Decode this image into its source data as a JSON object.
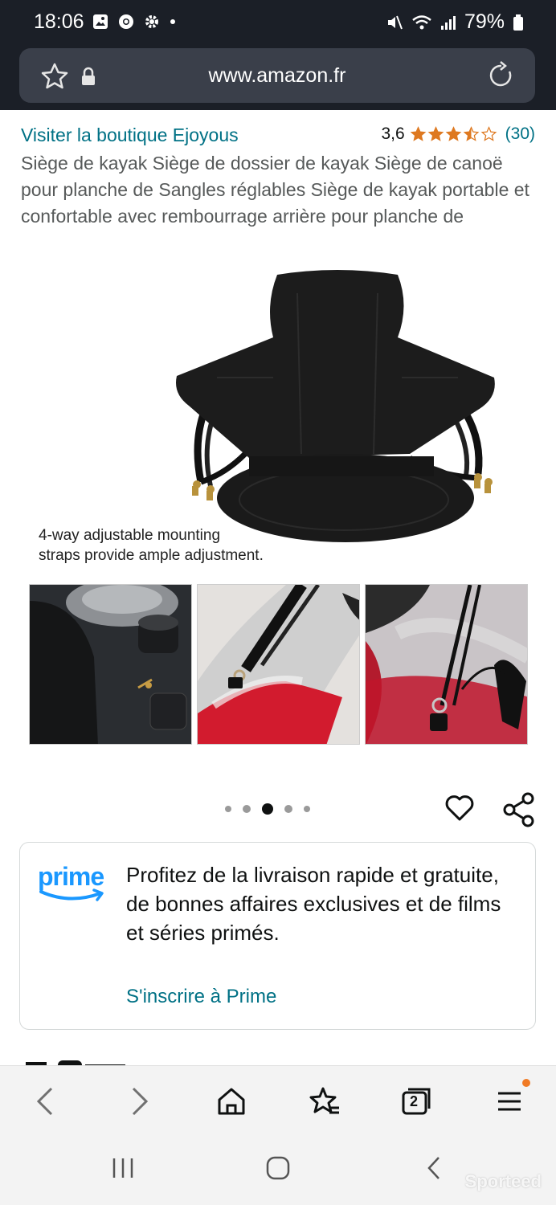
{
  "status_bar": {
    "time": "18:06",
    "battery": "79%"
  },
  "browser": {
    "url": "www.amazon.fr"
  },
  "product": {
    "store_link": "Visiter la boutique Ejoyous",
    "rating_value": "3,6",
    "rating_count": "(30)",
    "stars_fraction": 0.72,
    "title": "Siège de kayak Siège de dossier de kayak Siège de canoë pour planche de Sangles réglables Siège de kayak portable et confortable avec rembourrage arrière pour planche de",
    "image_caption_line1": "4-way adjustable mounting",
    "image_caption_line2": "straps provide ample adjustment."
  },
  "carousel": {
    "total": 5,
    "active_index": 2
  },
  "prime": {
    "logo": "prime",
    "text": "Profitez de la livraison rapide et gratuite, de bonnes affaires exclusives et de films et séries primés.",
    "link": "S'inscrire à Prime",
    "brand_color": "#1a98ff"
  },
  "bottom_nav": {
    "tabs_count": "2"
  },
  "watermark": "Sporteed",
  "colors": {
    "link": "#007185",
    "star": "#de7921",
    "status_bg": "#1b1f27"
  }
}
